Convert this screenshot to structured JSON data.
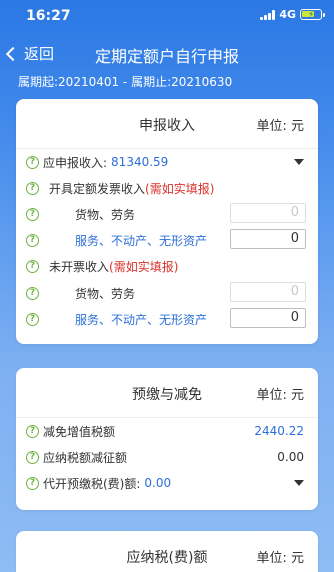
{
  "status": {
    "time": "16:27",
    "network": "4G"
  },
  "nav": {
    "back_label": "返回",
    "title": "定期定额户自行申报"
  },
  "period": {
    "text": "属期起:20210401 - 属期止:20210630"
  },
  "card1": {
    "title": "申报收入",
    "unit": "单位: 元",
    "declared_income_label": "应申报收入:",
    "declared_income_value": "81340.59",
    "invoiced_label": "开具定额发票收入",
    "invoiced_note": "(需如实填报)",
    "goods_label": "货物、劳务",
    "goods_value_1": "0",
    "services_label": "服务、不动产、无形资产",
    "services_value_1": "0",
    "not_invoiced_label": "未开票收入",
    "not_invoiced_note": "(需如实填报)",
    "goods_value_2": "0",
    "services_value_2": "0"
  },
  "card2": {
    "title": "预缴与减免",
    "unit": "单位: 元",
    "vat_reduction_label": "减免增值税额",
    "vat_reduction_value": "2440.22",
    "tax_reduction_label": "应纳税额减征额",
    "tax_reduction_value": "0.00",
    "prepaid_label": "代开预缴税(费)额:",
    "prepaid_value": "0.00"
  },
  "card3": {
    "title": "应纳税(费)额",
    "unit": "单位: 元"
  },
  "icons": {
    "help": "?",
    "help_color": "#6db33f"
  }
}
